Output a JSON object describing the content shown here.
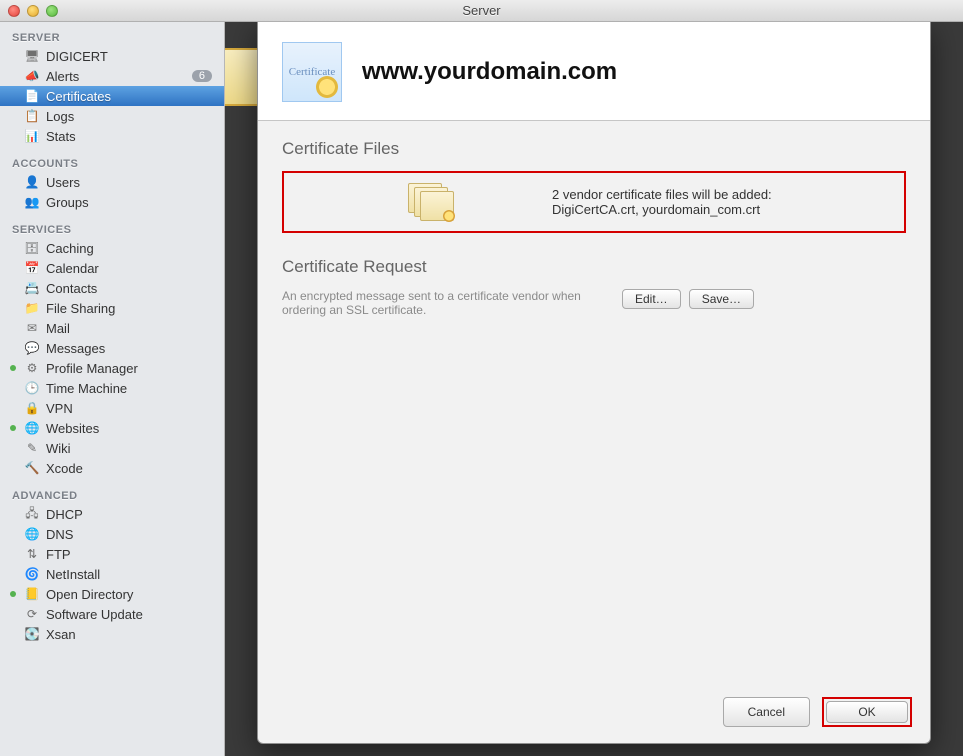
{
  "window": {
    "title": "Server"
  },
  "sidebar": {
    "sections": [
      {
        "header": "SERVER",
        "items": [
          {
            "label": "DIGICERT",
            "icon": "🖥",
            "badge": null,
            "dot": false
          },
          {
            "label": "Alerts",
            "icon": "📣",
            "badge": "6",
            "dot": false
          },
          {
            "label": "Certificates",
            "icon": "📄",
            "badge": null,
            "dot": false,
            "selected": true
          },
          {
            "label": "Logs",
            "icon": "📋",
            "badge": null,
            "dot": false
          },
          {
            "label": "Stats",
            "icon": "📊",
            "badge": null,
            "dot": false
          }
        ]
      },
      {
        "header": "ACCOUNTS",
        "items": [
          {
            "label": "Users",
            "icon": "👤",
            "badge": null,
            "dot": false
          },
          {
            "label": "Groups",
            "icon": "👥",
            "badge": null,
            "dot": false
          }
        ]
      },
      {
        "header": "SERVICES",
        "items": [
          {
            "label": "Caching",
            "icon": "🗄",
            "badge": null,
            "dot": false
          },
          {
            "label": "Calendar",
            "icon": "📅",
            "badge": null,
            "dot": false
          },
          {
            "label": "Contacts",
            "icon": "📇",
            "badge": null,
            "dot": false
          },
          {
            "label": "File Sharing",
            "icon": "📁",
            "badge": null,
            "dot": false
          },
          {
            "label": "Mail",
            "icon": "✉",
            "badge": null,
            "dot": false
          },
          {
            "label": "Messages",
            "icon": "💬",
            "badge": null,
            "dot": false
          },
          {
            "label": "Profile Manager",
            "icon": "⚙",
            "badge": null,
            "dot": true
          },
          {
            "label": "Time Machine",
            "icon": "🕒",
            "badge": null,
            "dot": false
          },
          {
            "label": "VPN",
            "icon": "🔒",
            "badge": null,
            "dot": false
          },
          {
            "label": "Websites",
            "icon": "🌐",
            "badge": null,
            "dot": true
          },
          {
            "label": "Wiki",
            "icon": "✎",
            "badge": null,
            "dot": false
          },
          {
            "label": "Xcode",
            "icon": "🔨",
            "badge": null,
            "dot": false
          }
        ]
      },
      {
        "header": "ADVANCED",
        "items": [
          {
            "label": "DHCP",
            "icon": "🖧",
            "badge": null,
            "dot": false
          },
          {
            "label": "DNS",
            "icon": "🌐",
            "badge": null,
            "dot": false
          },
          {
            "label": "FTP",
            "icon": "⇅",
            "badge": null,
            "dot": false
          },
          {
            "label": "NetInstall",
            "icon": "🌀",
            "badge": null,
            "dot": false
          },
          {
            "label": "Open Directory",
            "icon": "📒",
            "badge": null,
            "dot": true
          },
          {
            "label": "Software Update",
            "icon": "⟳",
            "badge": null,
            "dot": false
          },
          {
            "label": "Xsan",
            "icon": "💽",
            "badge": null,
            "dot": false
          }
        ]
      }
    ]
  },
  "sheet": {
    "domain": "www.yourdomain.com",
    "cert_icon_label": "Certificate",
    "files_title": "Certificate Files",
    "files_line1": "2 vendor certificate files will be added:",
    "files_line2": "DigiCertCA.crt, yourdomain_com.crt",
    "request_title": "Certificate Request",
    "request_desc": "An encrypted message sent to a certificate vendor when ordering an SSL certificate.",
    "edit_label": "Edit…",
    "save_label": "Save…",
    "cancel_label": "Cancel",
    "ok_label": "OK"
  }
}
